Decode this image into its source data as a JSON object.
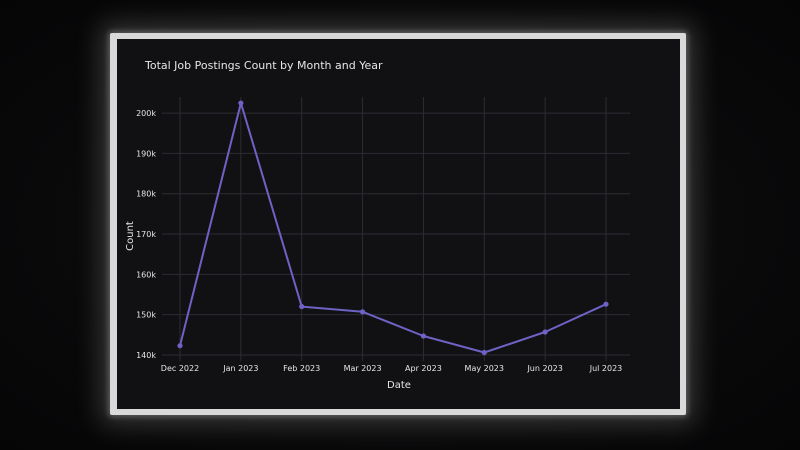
{
  "chart_data": {
    "type": "line",
    "title": "Total Job Postings Count by Month and Year",
    "xlabel": "Date",
    "ylabel": "Count",
    "categories": [
      "Dec 2022",
      "Jan 2023",
      "Feb 2023",
      "Mar 2023",
      "Apr 2023",
      "May 2023",
      "Jun 2023",
      "Jul 2023"
    ],
    "series": [
      {
        "values": [
          142300,
          202500,
          152000,
          150700,
          144700,
          140600,
          145700,
          152600
        ]
      }
    ],
    "y_ticks": [
      140000,
      150000,
      160000,
      170000,
      180000,
      190000,
      200000
    ],
    "y_tick_labels": [
      "140k",
      "150k",
      "160k",
      "170k",
      "180k",
      "190k",
      "200k"
    ],
    "ylim": [
      138500,
      204000
    ],
    "grid": true,
    "colors": {
      "line": "#6e62c4",
      "grid": "#2c2c34",
      "text": "#e6e6e6",
      "background": "#111113"
    }
  }
}
